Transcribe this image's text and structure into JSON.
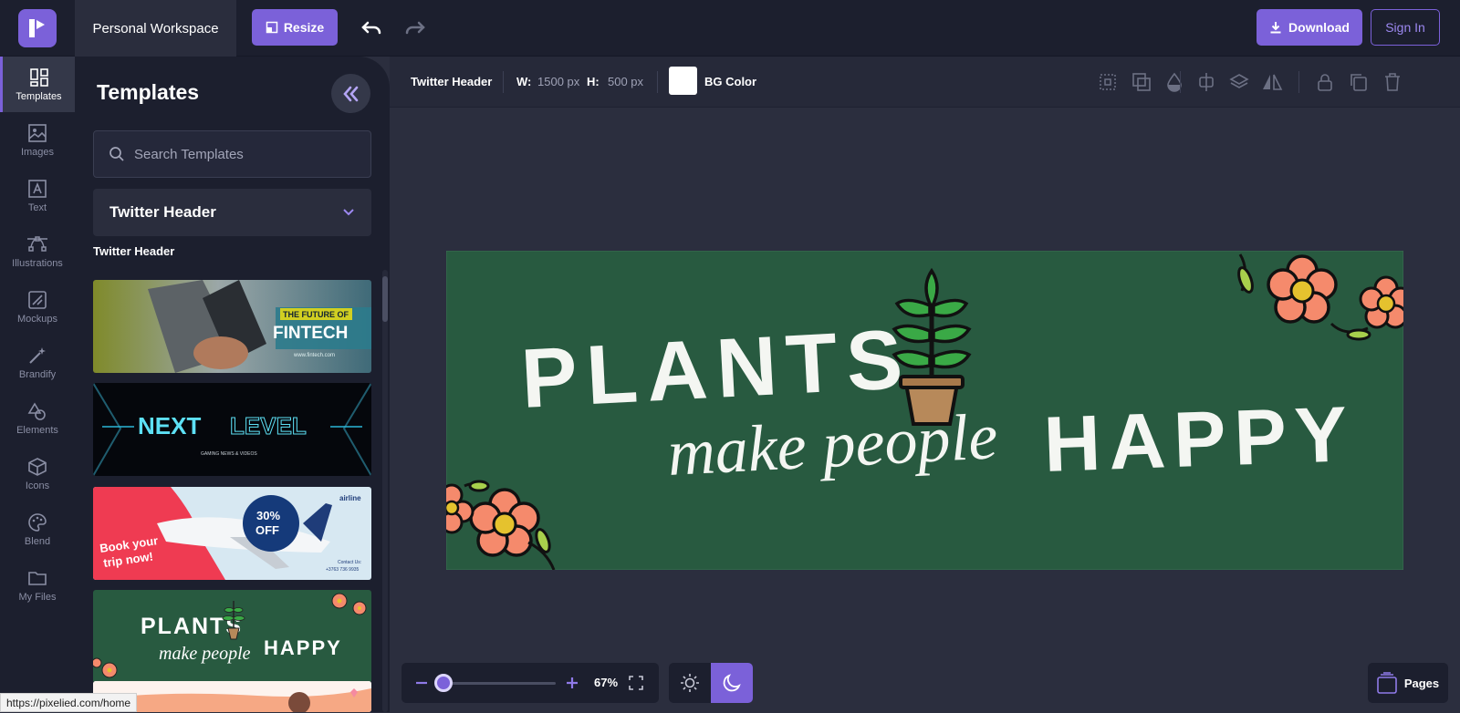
{
  "header": {
    "workspace": "Personal Workspace",
    "resize_label": "Resize",
    "download_label": "Download",
    "signin_label": "Sign In"
  },
  "rail": {
    "items": [
      {
        "label": "Templates",
        "icon": "templates-icon"
      },
      {
        "label": "Images",
        "icon": "image-icon"
      },
      {
        "label": "Text",
        "icon": "text-icon"
      },
      {
        "label": "Illustrations",
        "icon": "illustrations-icon"
      },
      {
        "label": "Mockups",
        "icon": "mockups-icon"
      },
      {
        "label": "Brandify",
        "icon": "magic-wand-icon"
      },
      {
        "label": "Elements",
        "icon": "elements-icon"
      },
      {
        "label": "Icons",
        "icon": "cube-icon"
      },
      {
        "label": "Blend",
        "icon": "palette-icon"
      },
      {
        "label": "My Files",
        "icon": "folder-icon"
      }
    ]
  },
  "panel": {
    "title": "Templates",
    "search_placeholder": "Search Templates",
    "category": "Twitter Header",
    "section_label": "Twitter Header",
    "templates": [
      {
        "line1": "THE FUTURE OF",
        "line2": "FINTECH",
        "line3": "www.fintech.com"
      },
      {
        "line1": "NEXT",
        "line2": "LEVEL",
        "line3": "GAMING NEWS & VIDEOS"
      },
      {
        "line1": "Book your",
        "line2": "trip now!",
        "badge1": "30%",
        "badge2": "OFF",
        "brand": "airline",
        "contact1": "Contact Us:",
        "contact2": "+3763 736 9935"
      },
      {
        "line1": "PLANTS",
        "line2": "make people",
        "line3": "HAPPY"
      }
    ]
  },
  "props": {
    "type_label": "Twitter Header",
    "w_label": "W:",
    "w_value": "1500 px",
    "h_label": "H:",
    "h_value": "500 px",
    "bg_label": "BG Color",
    "bg_color": "#ffffff"
  },
  "artboard": {
    "bg": "#285a40",
    "line1": "PLANTS",
    "line2": "make people",
    "line3": "HAPPY"
  },
  "zoom": {
    "value": "67%",
    "level": 0.2
  },
  "pages_label": "Pages",
  "status_url": "https://pixelied.com/home",
  "colors": {
    "accent": "#7b61d9",
    "panel": "#1c1f2e",
    "canvas": "#2b2e3e"
  }
}
